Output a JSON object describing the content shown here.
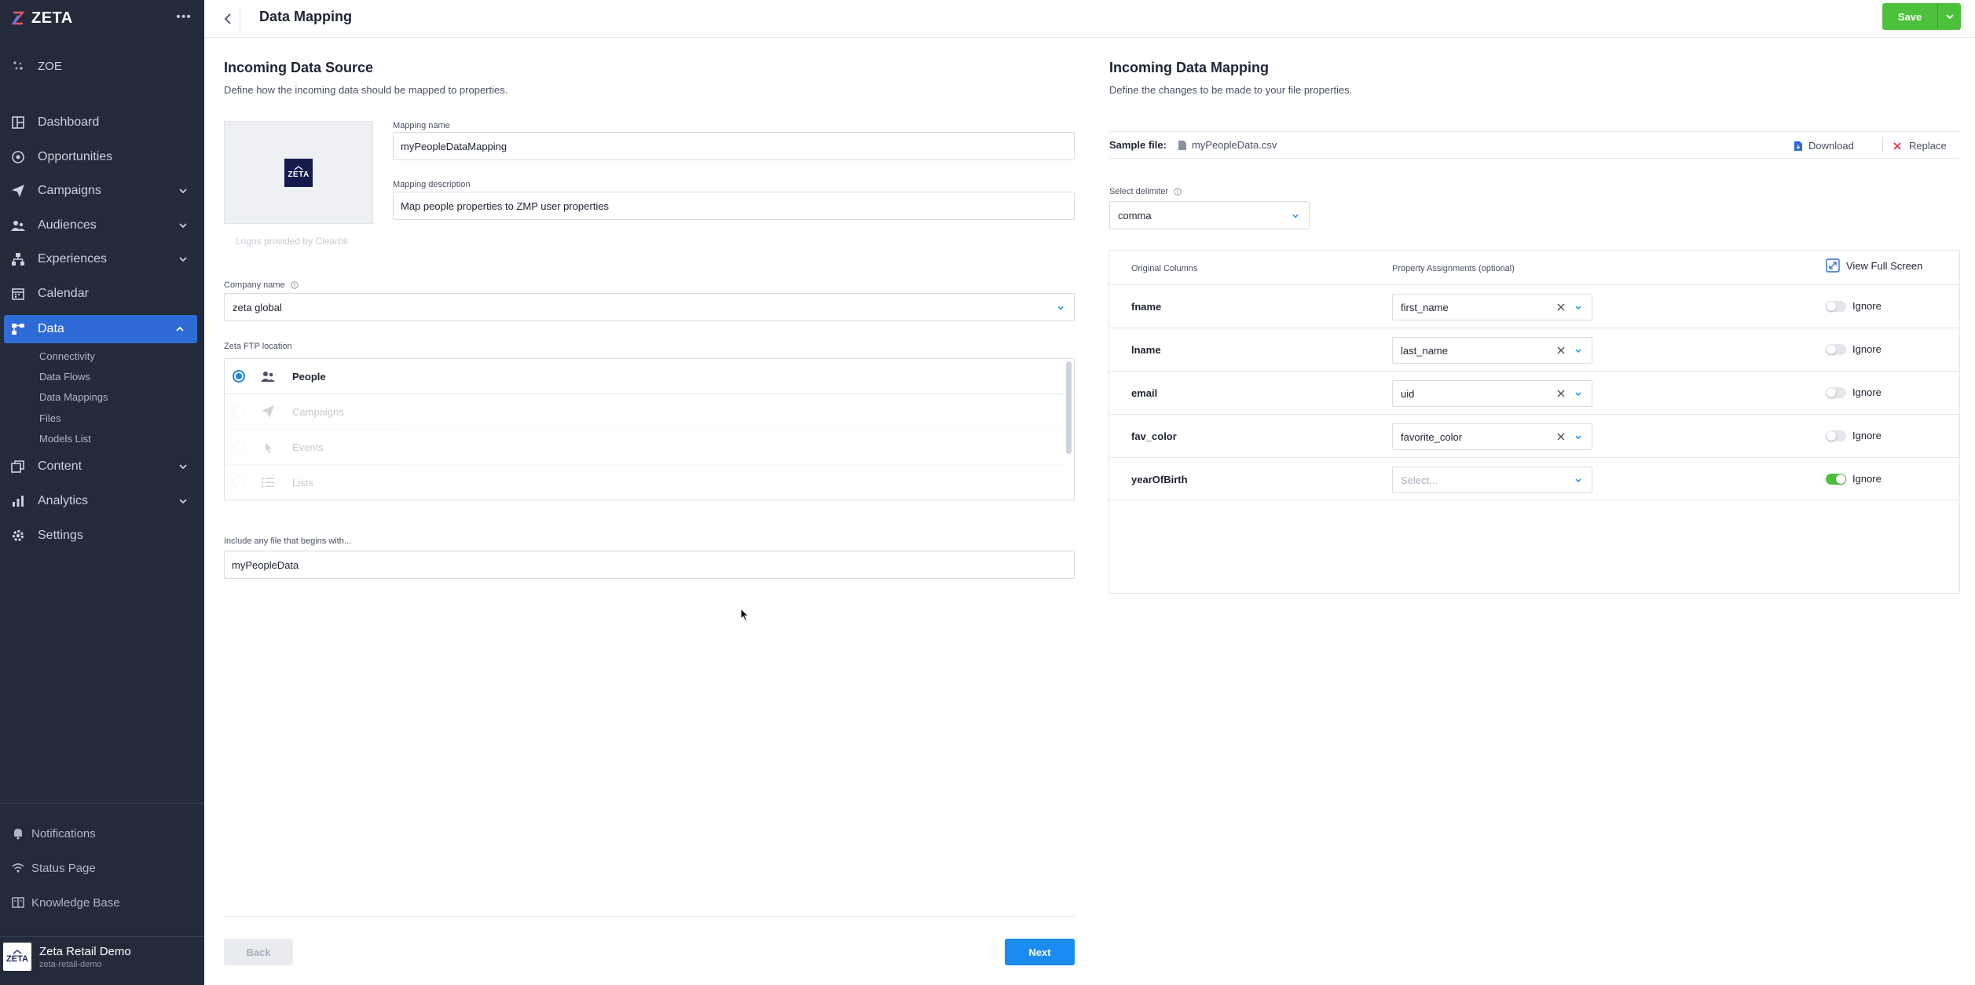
{
  "brand": {
    "name": "ZETA"
  },
  "sidebar": {
    "zoe": "ZOE",
    "items": [
      {
        "label": "Dashboard"
      },
      {
        "label": "Opportunities"
      },
      {
        "label": "Campaigns"
      },
      {
        "label": "Audiences"
      },
      {
        "label": "Experiences"
      },
      {
        "label": "Calendar"
      },
      {
        "label": "Data"
      },
      {
        "label": "Content"
      },
      {
        "label": "Analytics"
      },
      {
        "label": "Settings"
      }
    ],
    "data_sub": [
      "Connectivity",
      "Data Flows",
      "Data Mappings",
      "Files",
      "Models List"
    ],
    "footer": [
      "Notifications",
      "Status Page",
      "Knowledge Base"
    ],
    "account": {
      "name": "Zeta Retail Demo",
      "sub": "zeta-retail-demo",
      "avatar_text": "ZETA"
    }
  },
  "topbar": {
    "title": "Data Mapping",
    "save_label": "Save"
  },
  "left": {
    "heading": "Incoming Data Source",
    "subtitle": "Define how the incoming data should be mapped to properties.",
    "logo_text": "ZETA",
    "logo_caption": "Logos provided by Clearbit",
    "mapping_name_label": "Mapping name",
    "mapping_name_value": "myPeopleDataMapping",
    "mapping_desc_label": "Mapping description",
    "mapping_desc_value": "Map people properties to ZMP user properties",
    "company_label": "Company name",
    "company_value": "zeta global",
    "ftp_label": "Zeta FTP location",
    "ftp_options": [
      "People",
      "Campaigns",
      "Events",
      "Lists"
    ],
    "prefix_label": "Include any file that begins with...",
    "prefix_value": "myPeopleData",
    "back_label": "Back",
    "next_label": "Next"
  },
  "right": {
    "heading": "Incoming Data Mapping",
    "subtitle": "Define the changes to be made to your file properties.",
    "sample_label": "Sample file:",
    "sample_file": "myPeopleData.csv",
    "download_label": "Download",
    "replace_label": "Replace",
    "delimiter_label": "Select delimiter",
    "delimiter_value": "comma",
    "col_original": "Original Columns",
    "col_property": "Property Assignments (optional)",
    "view_full_screen": "View Full Screen",
    "ignore_label": "Ignore",
    "rows": [
      {
        "column": "fname",
        "property": "first_name",
        "ignored": false
      },
      {
        "column": "lname",
        "property": "last_name",
        "ignored": false
      },
      {
        "column": "email",
        "property": "uid",
        "ignored": false
      },
      {
        "column": "fav_color",
        "property": "favorite_color",
        "ignored": false
      },
      {
        "column": "yearOfBirth",
        "property": "Select...",
        "ignored": true
      }
    ]
  },
  "colors": {
    "accent_blue": "#2f6bd6",
    "save_green": "#4cc13c",
    "next_blue": "#1a8cf0",
    "sidebar_bg": "#232b3a"
  }
}
